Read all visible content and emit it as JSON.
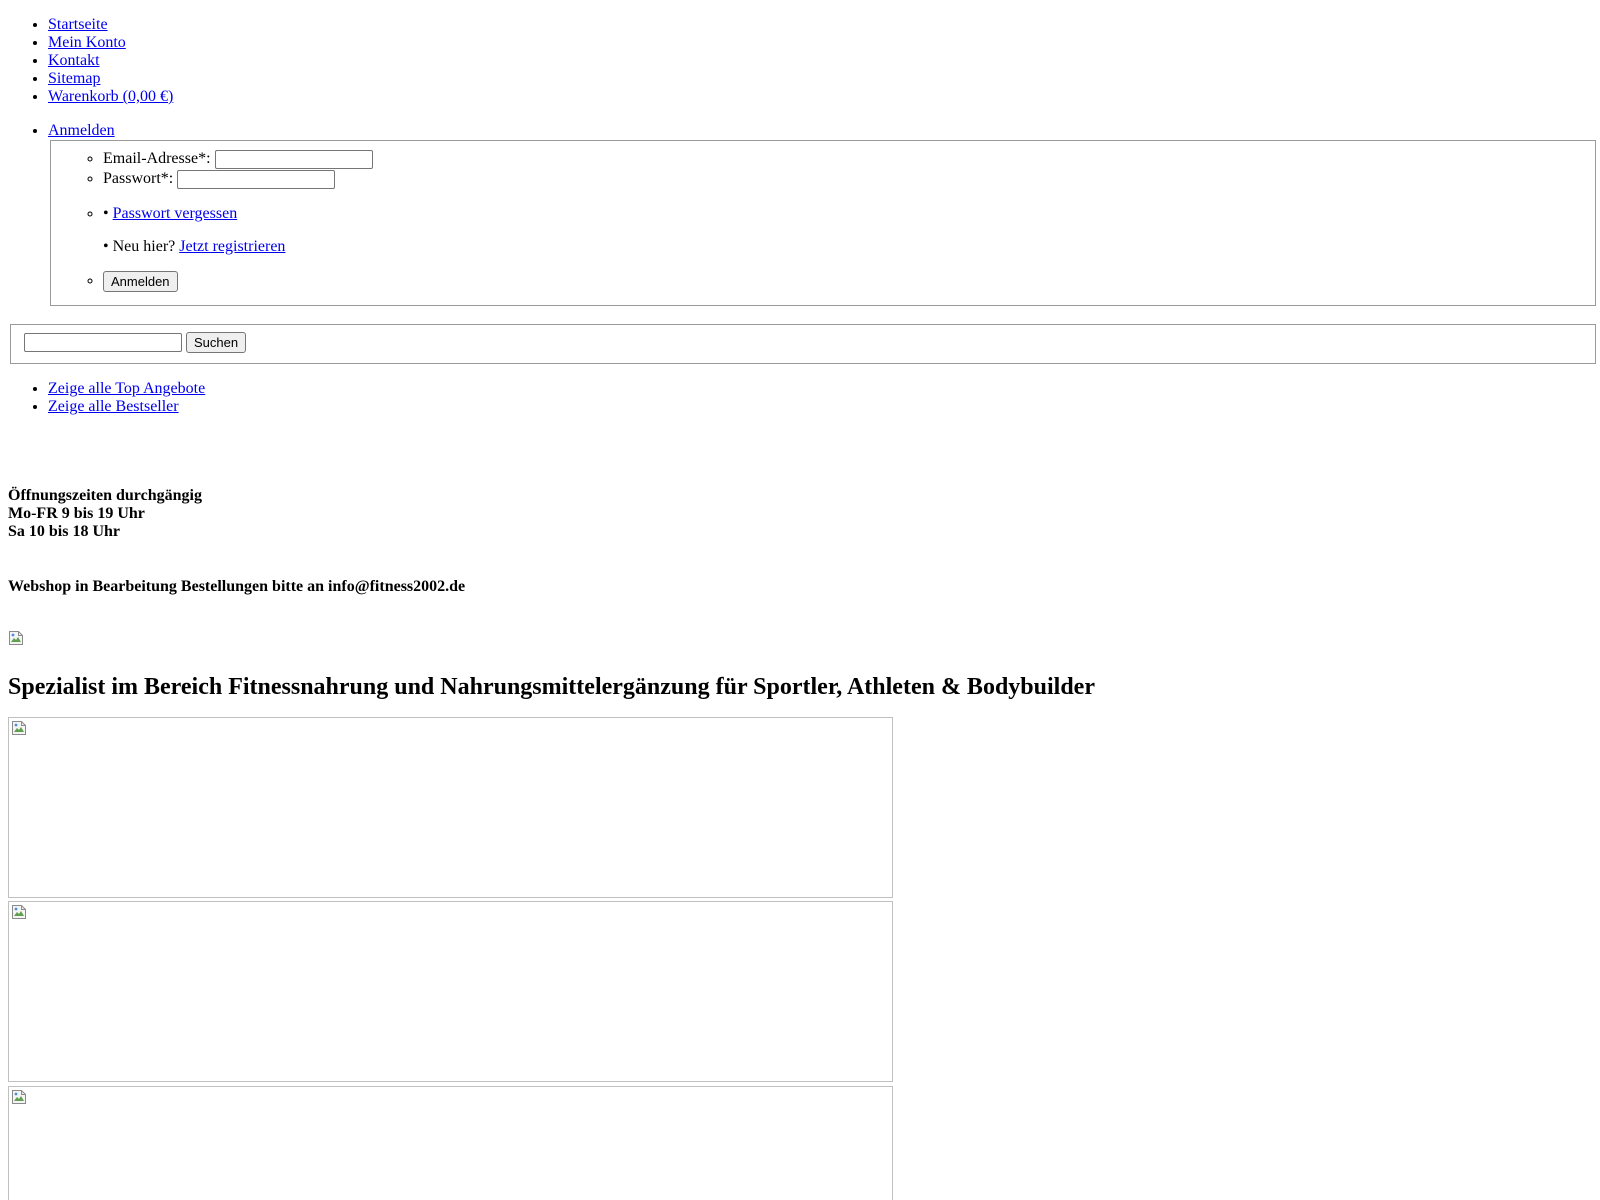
{
  "topnav": {
    "items": [
      {
        "label": "Startseite"
      },
      {
        "label": "Mein Konto"
      },
      {
        "label": "Kontakt"
      },
      {
        "label": "Sitemap"
      },
      {
        "label": "Warenkorb (0,00 €)"
      }
    ]
  },
  "login": {
    "toggle_label": "Anmelden",
    "email_label": "Email-Adresse*:",
    "email_value": "",
    "password_label": "Passwort*:",
    "password_value": "",
    "bullet": "•",
    "forgot_label": "Passwort vergessen",
    "new_here_text": "Neu hier?",
    "register_label": "Jetzt registrieren",
    "submit_label": "Anmelden"
  },
  "search": {
    "value": "",
    "button_label": "Suchen"
  },
  "offers": {
    "items": [
      {
        "label": "Zeige alle Top Angebote"
      },
      {
        "label": "Zeige alle Bestseller"
      }
    ]
  },
  "hours": {
    "line1": "Öffnungszeiten durchgängig",
    "line2": "Mo-FR 9 bis 19 Uhr",
    "line3": "Sa 10 bis 18 Uhr"
  },
  "notice": "Webshop in Bearbeitung Bestellungen bitte an info@fitness2002.de",
  "headline": "Spezialist im Bereich Fitnessnahrung und Nahrungsmittelergänzung für Sportler, Athleten & Bodybuilder",
  "icons": {
    "broken_image": "broken-image-icon"
  },
  "colors": {
    "link": "#0000ee",
    "border": "#9a9a9a"
  }
}
